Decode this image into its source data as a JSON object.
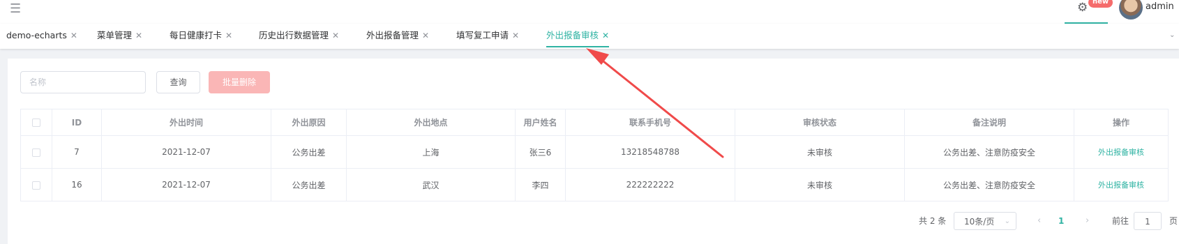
{
  "header": {
    "menu_icon": "hamburger-icon",
    "settings_icon": "gear-icon",
    "badge": "new",
    "user_name": "admin"
  },
  "tabs": [
    {
      "label": "demo-echarts"
    },
    {
      "label": "菜单管理"
    },
    {
      "label": "每日健康打卡"
    },
    {
      "label": "历史出行数据管理"
    },
    {
      "label": "外出报备管理"
    },
    {
      "label": "填写复工申请"
    },
    {
      "label": "外出报备审核",
      "active": true
    }
  ],
  "toolbar": {
    "search_placeholder": "名称",
    "query_label": "查询",
    "batch_delete_label": "批量删除"
  },
  "table": {
    "columns": [
      "ID",
      "外出时间",
      "外出原因",
      "外出地点",
      "用户姓名",
      "联系手机号",
      "审核状态",
      "备注说明",
      "操作"
    ],
    "rows": [
      {
        "id": "7",
        "time": "2021-12-07",
        "reason": "公务出差",
        "place": "上海",
        "user": "张三6",
        "phone": "13218548788",
        "status": "未审核",
        "remark": "公务出差、注意防疫安全",
        "action": "外出报备审核"
      },
      {
        "id": "16",
        "time": "2021-12-07",
        "reason": "公务出差",
        "place": "武汉",
        "user": "李四",
        "phone": "222222222",
        "status": "未审核",
        "remark": "公务出差、注意防疫安全",
        "action": "外出报备审核"
      }
    ]
  },
  "pagination": {
    "total": "共 2 条",
    "page_size": "10条/页",
    "current_page": "1",
    "goto_label": "前往",
    "goto_value": "1",
    "page_unit": "页"
  },
  "colors": {
    "accent": "#2fb3a3",
    "danger_light": "#fab6b6",
    "badge": "#f56c6c",
    "annotation_arrow": "#f04a4a"
  }
}
